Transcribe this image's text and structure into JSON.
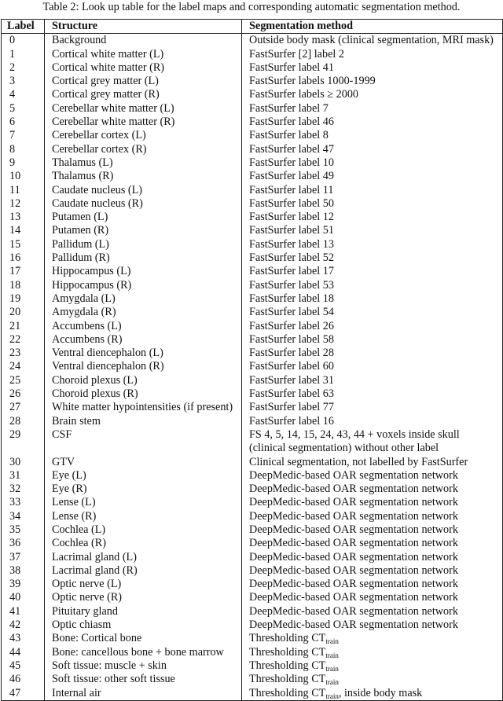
{
  "caption": "Table 2: Look up table for the label maps and corresponding automatic segmentation method.",
  "table": {
    "headers": [
      "Label",
      "Structure",
      "Segmentation method"
    ],
    "rows": [
      {
        "label": "0",
        "structure": "Background",
        "method": "Outside body mask (clinical segmentation, MRI mask)"
      },
      {
        "label": "1",
        "structure": "Cortical white matter (L)",
        "method": "FastSurfer [2] label 2"
      },
      {
        "label": "2",
        "structure": "Cortical white matter (R)",
        "method": "FastSurfer label 41"
      },
      {
        "label": "3",
        "structure": "Cortical grey matter (L)",
        "method": "FastSurfer labels 1000-1999"
      },
      {
        "label": "4",
        "structure": "Cortical grey matter (R)",
        "method": "FastSurfer labels ≥ 2000"
      },
      {
        "label": "5",
        "structure": "Cerebellar white matter (L)",
        "method": "FastSurfer label 7"
      },
      {
        "label": "6",
        "structure": "Cerebellar white matter (R)",
        "method": "FastSurfer label 46"
      },
      {
        "label": "7",
        "structure": "Cerebellar cortex (L)",
        "method": "FastSurfer label 8"
      },
      {
        "label": "8",
        "structure": "Cerebellar cortex (R)",
        "method": "FastSurfer label 47"
      },
      {
        "label": "9",
        "structure": "Thalamus (L)",
        "method": "FastSurfer label 10"
      },
      {
        "label": "10",
        "structure": "Thalamus (R)",
        "method": "FastSurfer label 49"
      },
      {
        "label": "11",
        "structure": "Caudate nucleus (L)",
        "method": "FastSurfer label 11"
      },
      {
        "label": "12",
        "structure": "Caudate nucleus (R)",
        "method": "FastSurfer label 50"
      },
      {
        "label": "13",
        "structure": "Putamen (L)",
        "method": "FastSurfer label 12"
      },
      {
        "label": "14",
        "structure": "Putamen (R)",
        "method": "FastSurfer label 51"
      },
      {
        "label": "15",
        "structure": "Pallidum (L)",
        "method": "FastSurfer label 13"
      },
      {
        "label": "16",
        "structure": "Pallidum (R)",
        "method": "FastSurfer label 52"
      },
      {
        "label": "17",
        "structure": "Hippocampus (L)",
        "method": "FastSurfer label 17"
      },
      {
        "label": "18",
        "structure": "Hippocampus (R)",
        "method": "FastSurfer label 53"
      },
      {
        "label": "19",
        "structure": "Amygdala (L)",
        "method": "FastSurfer label 18"
      },
      {
        "label": "20",
        "structure": "Amygdala (R)",
        "method": "FastSurfer label 54"
      },
      {
        "label": "21",
        "structure": "Accumbens (L)",
        "method": "FastSurfer label 26"
      },
      {
        "label": "22",
        "structure": "Accumbens (R)",
        "method": "FastSurfer label 58"
      },
      {
        "label": "23",
        "structure": "Ventral diencephalon (L)",
        "method": "FastSurfer label 28"
      },
      {
        "label": "24",
        "structure": "Ventral diencephalon (R)",
        "method": "FastSurfer label 60"
      },
      {
        "label": "25",
        "structure": "Choroid plexus (L)",
        "method": "FastSurfer label 31"
      },
      {
        "label": "26",
        "structure": "Choroid plexus (R)",
        "method": "FastSurfer label 63"
      },
      {
        "label": "27",
        "structure": "White matter hypointensities (if present)",
        "method": "FastSurfer label 77"
      },
      {
        "label": "28",
        "structure": "Brain stem",
        "method": "FastSurfer label 16"
      },
      {
        "label": "29",
        "structure": "CSF",
        "method": "FS 4, 5, 14, 15, 24, 43, 44 + voxels inside skull",
        "method_line2": "(clinical segmentation) without other label"
      },
      {
        "label": "30",
        "structure": "GTV",
        "method": "Clinical segmentation, not labelled by FastSurfer"
      },
      {
        "label": "31",
        "structure": "Eye (L)",
        "method": "DeepMedic-based OAR segmentation network"
      },
      {
        "label": "32",
        "structure": "Eye (R)",
        "method": "DeepMedic-based OAR segmentation network"
      },
      {
        "label": "33",
        "structure": "Lense (L)",
        "method": "DeepMedic-based OAR segmentation network"
      },
      {
        "label": "34",
        "structure": "Lense (R)",
        "method": "DeepMedic-based OAR segmentation network"
      },
      {
        "label": "35",
        "structure": "Cochlea (L)",
        "method": "DeepMedic-based OAR segmentation network"
      },
      {
        "label": "36",
        "structure": "Cochlea (R)",
        "method": "DeepMedic-based OAR segmentation network"
      },
      {
        "label": "37",
        "structure": "Lacrimal gland (L)",
        "method": "DeepMedic-based OAR segmentation network"
      },
      {
        "label": "38",
        "structure": "Lacrimal gland (R)",
        "method": "DeepMedic-based OAR segmentation network"
      },
      {
        "label": "39",
        "structure": "Optic nerve (L)",
        "method": "DeepMedic-based OAR segmentation network"
      },
      {
        "label": "40",
        "structure": "Optic nerve (R)",
        "method": "DeepMedic-based OAR segmentation network"
      },
      {
        "label": "41",
        "structure": "Pituitary gland",
        "method": "DeepMedic-based OAR segmentation network"
      },
      {
        "label": "42",
        "structure": "Optic chiasm",
        "method": "DeepMedic-based OAR segmentation network"
      },
      {
        "label": "43",
        "structure": "Bone: Cortical bone",
        "method": "Thresholding CT",
        "method_sub": "train"
      },
      {
        "label": "44",
        "structure": "Bone: cancellous bone + bone marrow",
        "method": "Thresholding CT",
        "method_sub": "train"
      },
      {
        "label": "45",
        "structure": "Soft tissue: muscle + skin",
        "method": "Thresholding CT",
        "method_sub": "train"
      },
      {
        "label": "46",
        "structure": "Soft tissue: other soft tissue",
        "method": "Thresholding CT",
        "method_sub": "train"
      },
      {
        "label": "47",
        "structure": "Internal air",
        "method": "Thresholding CT",
        "method_sub": "train",
        "method_suffix": ", inside body mask"
      }
    ]
  }
}
